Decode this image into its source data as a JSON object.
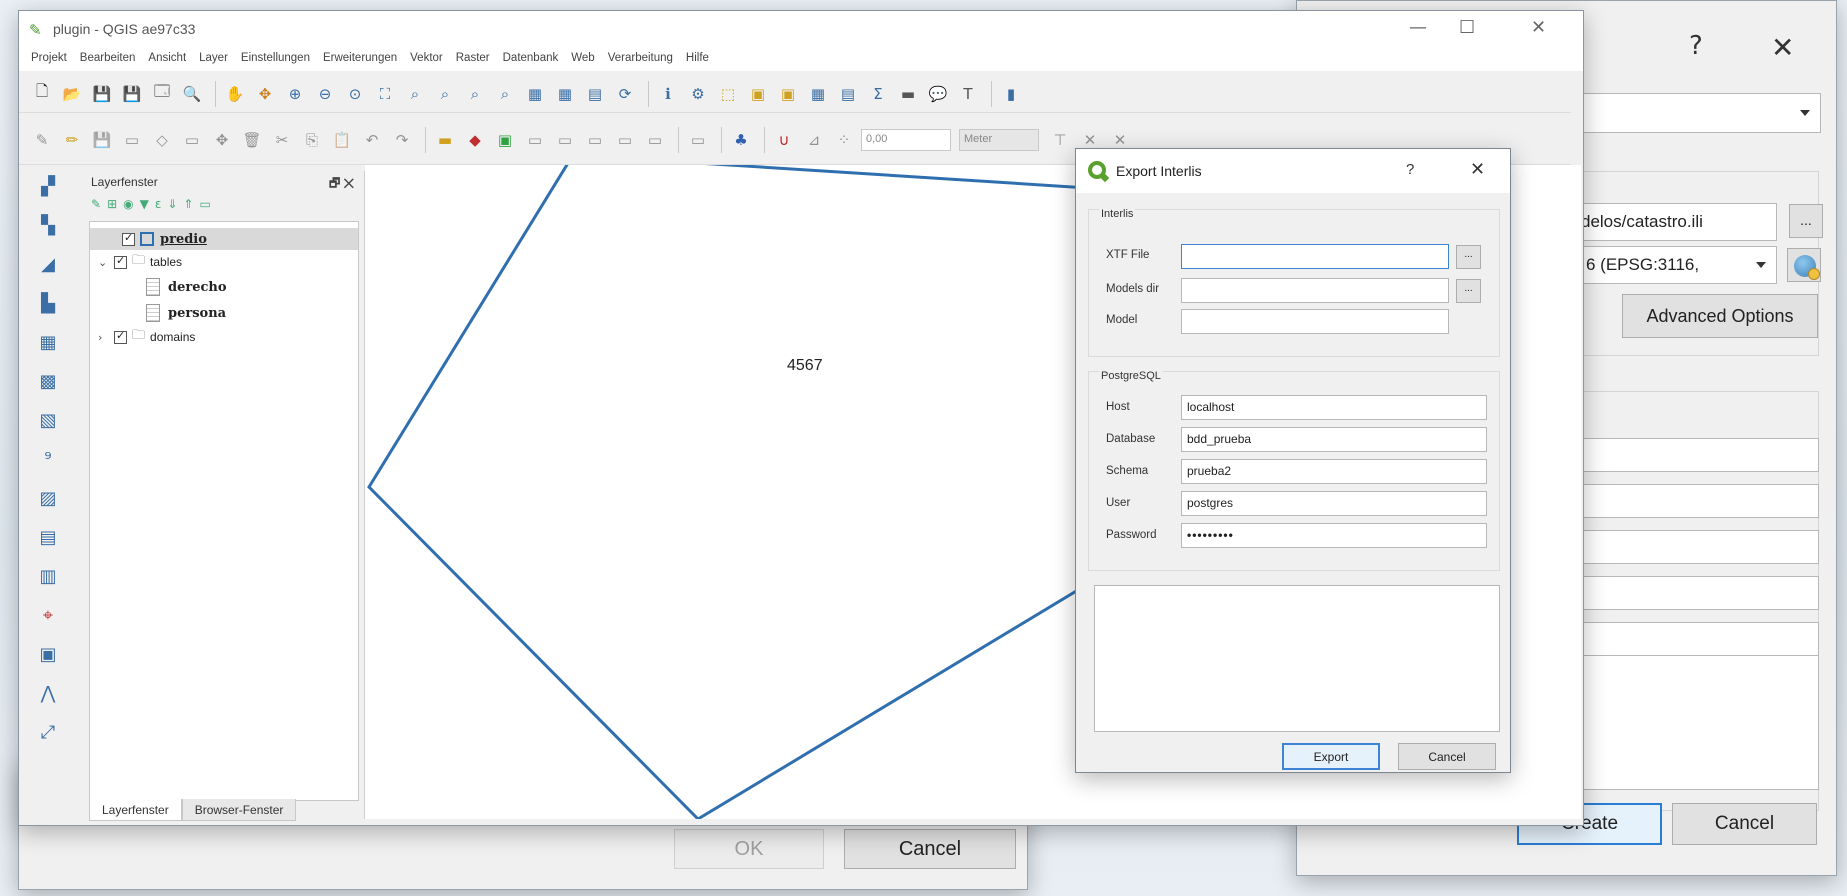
{
  "bg_left": {
    "ok_label": "OK",
    "cancel_label": "Cancel"
  },
  "bg_right": {
    "help_label": "?",
    "close_label": "✕",
    "ili_path": "delos/catastro.ili",
    "browse_label": "...",
    "crs_value": "6 (EPSG:3116,",
    "advanced_label": "Advanced Options",
    "create_label": "Create",
    "cancel_label": "Cancel"
  },
  "qgis": {
    "title": "plugin - QGIS ae97c33",
    "minimize": "—",
    "maximize": "☐",
    "close": "✕",
    "menus": [
      "Projekt",
      "Bearbeiten",
      "Ansicht",
      "Layer",
      "Einstellungen",
      "Erweiterungen",
      "Vektor",
      "Raster",
      "Datenbank",
      "Web",
      "Verarbeitung",
      "Hilfe"
    ],
    "snap_value": "0,00",
    "unit_value": "Meter",
    "layers_panel": {
      "title": "Layerfenster",
      "float_icon": "🗗 ✕",
      "tree": {
        "predio": "predio",
        "tables": "tables",
        "derecho": "derecho",
        "persona": "persona",
        "domains": "domains"
      },
      "tabs": [
        "Layerfenster",
        "Browser-Fenster"
      ]
    },
    "map": {
      "feature_label": "4567",
      "stroke_color": "#2f6fb0"
    }
  },
  "export_dialog": {
    "title": "Export Interlis",
    "help": "?",
    "close": "✕",
    "interlis_group": "Interlis",
    "xtf_label": "XTF File",
    "xtf_value": "",
    "models_dir_label": "Models dir",
    "models_dir_value": "",
    "model_label": "Model",
    "model_value": "",
    "browse_label": "...",
    "pg_group": "PostgreSQL",
    "host_label": "Host",
    "host_value": "localhost",
    "database_label": "Database",
    "database_value": "bdd_prueba",
    "schema_label": "Schema",
    "schema_value": "prueba2",
    "user_label": "User",
    "user_value": "postgres",
    "password_label": "Password",
    "password_value": "•••••••••",
    "export_label": "Export",
    "cancel_label": "Cancel"
  }
}
